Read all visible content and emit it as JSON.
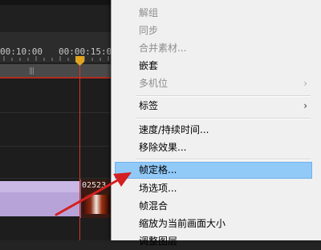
{
  "timeline": {
    "tick_labels": [
      "00:10:00",
      "00:00:15:00"
    ],
    "clip_label": "02523",
    "colors": {
      "playhead": "#d8362b",
      "playhead_head": "#e0a420",
      "clip_purple": "#b8a3d9"
    }
  },
  "context_menu": {
    "items": [
      {
        "label": "解组",
        "enabled": false
      },
      {
        "label": "同步",
        "enabled": false
      },
      {
        "label": "合并素材...",
        "enabled": false
      },
      {
        "label": "嵌套",
        "enabled": true
      },
      {
        "label": "多机位",
        "enabled": false,
        "submenu": true
      },
      {
        "label": "标签",
        "enabled": true,
        "submenu": true
      },
      {
        "label": "速度/持续时间...",
        "enabled": true
      },
      {
        "label": "移除效果...",
        "enabled": true
      },
      {
        "label": "帧定格...",
        "enabled": true,
        "highlighted": true
      },
      {
        "label": "场选项...",
        "enabled": true
      },
      {
        "label": "帧混合",
        "enabled": true
      },
      {
        "label": "缩放为当前画面大小",
        "enabled": true
      },
      {
        "label": "调整图层",
        "enabled": true
      }
    ],
    "submenu_arrow": "›",
    "highlight_color": "#91c9f7"
  },
  "annotation": {
    "arrow_color": "#d42020"
  }
}
